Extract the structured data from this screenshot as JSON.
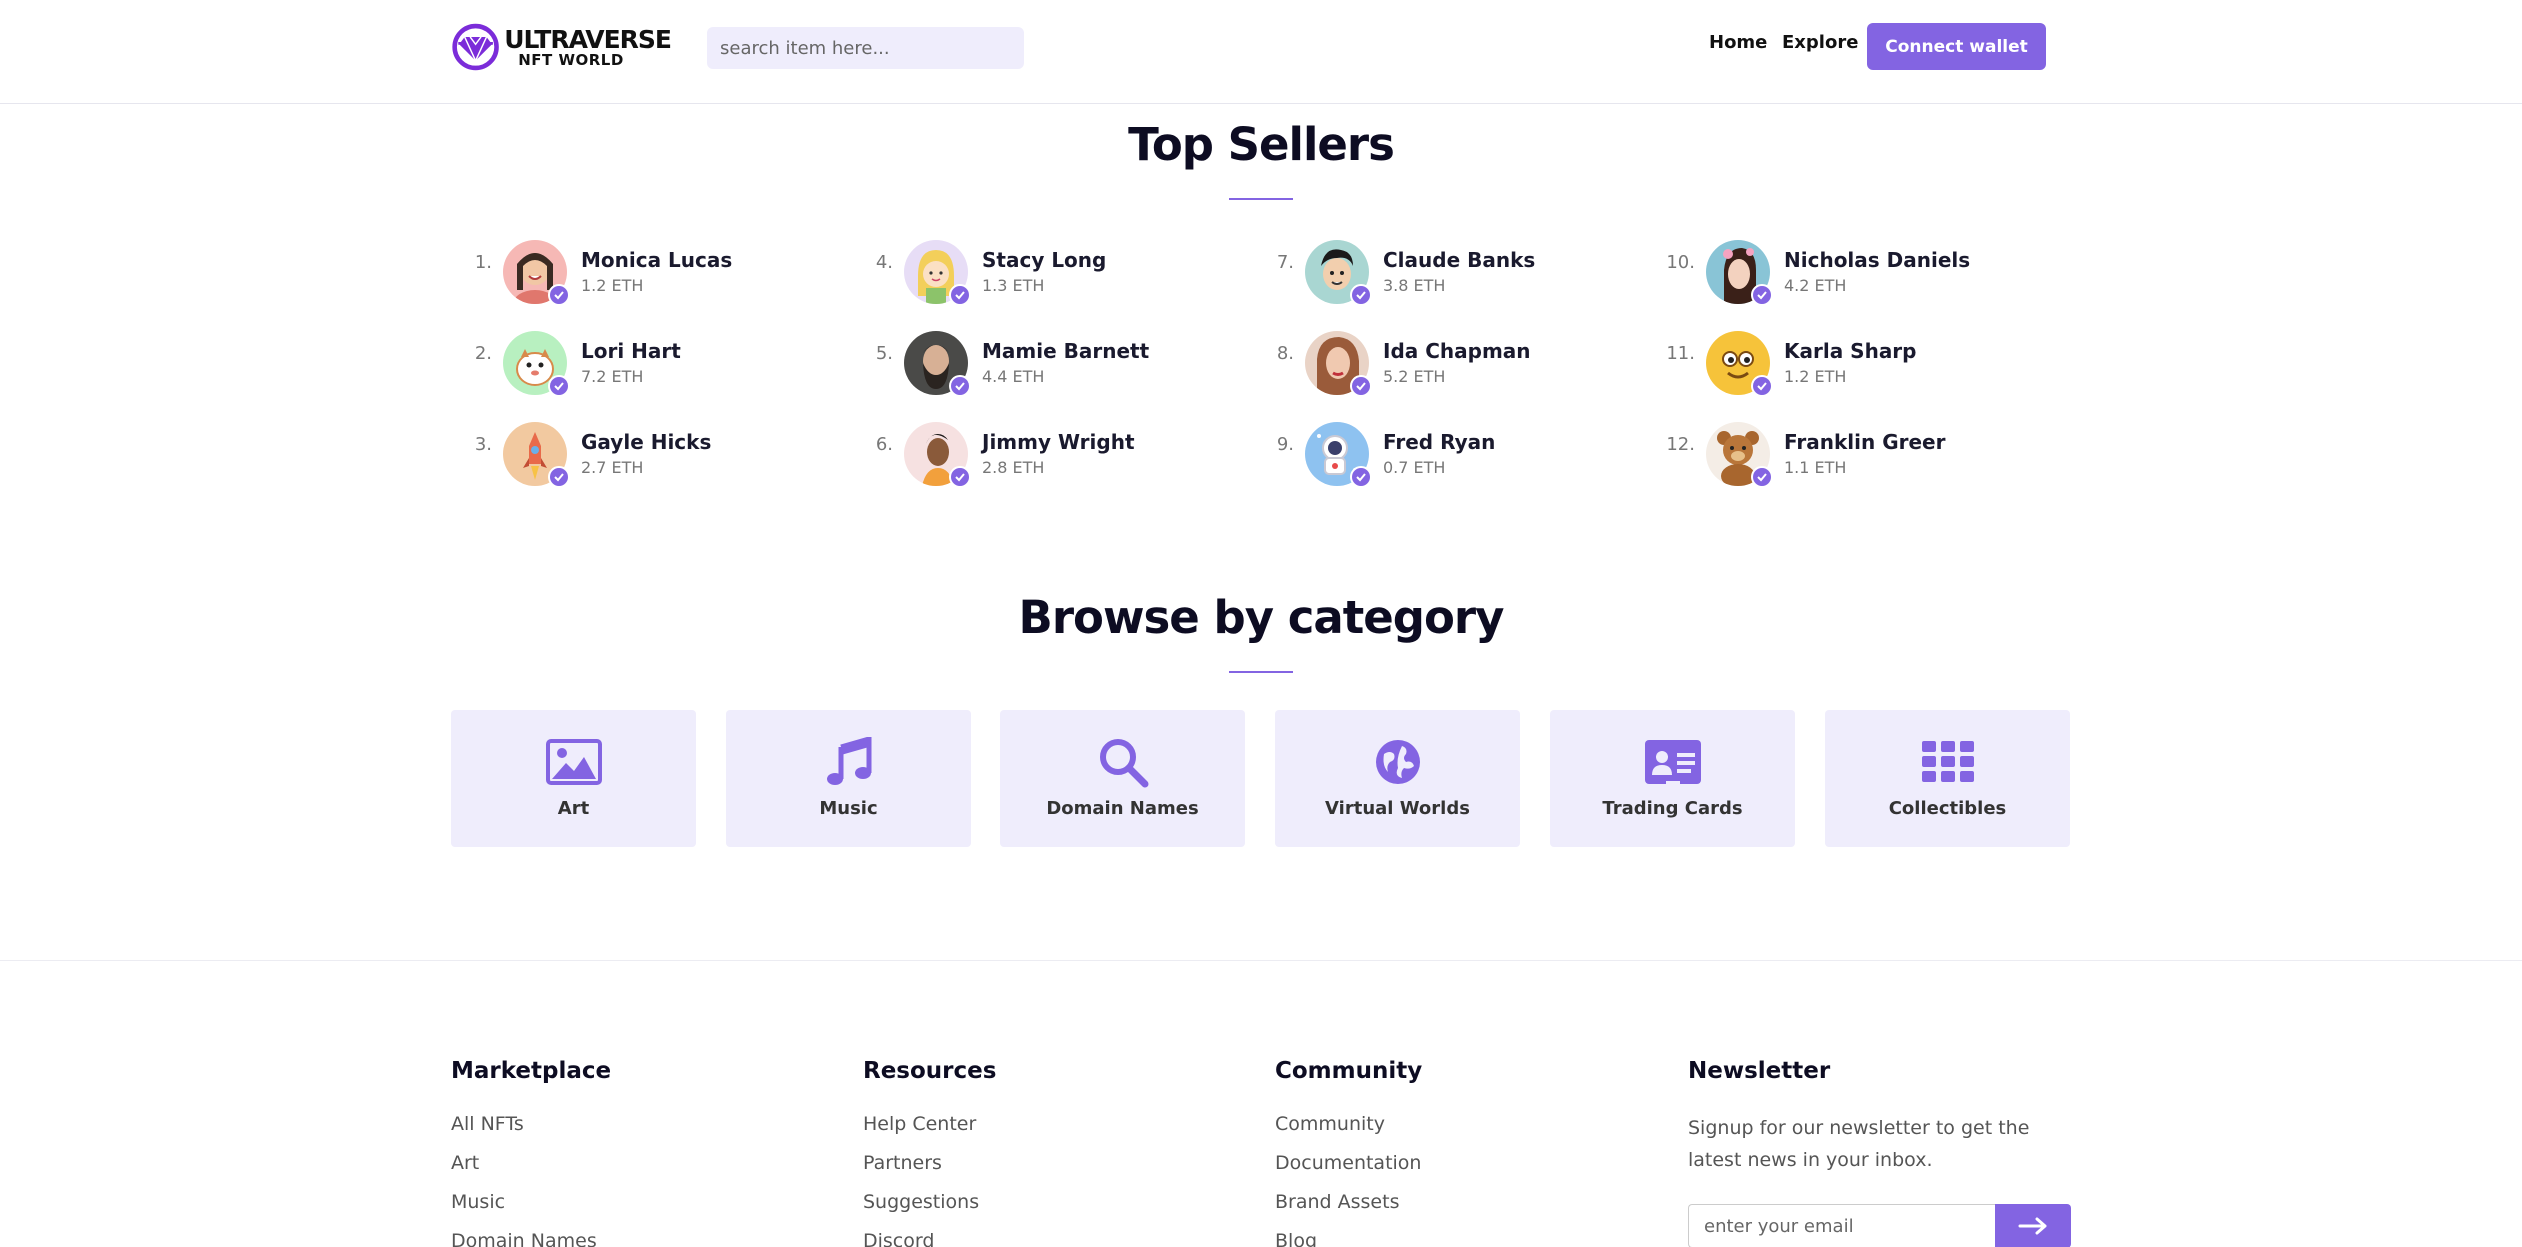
{
  "header": {
    "logo_main": "ULTRAVERSE",
    "logo_sub": "NFT WORLD",
    "search_placeholder": "search item here...",
    "nav": [
      {
        "label": "Home"
      },
      {
        "label": "Explore"
      }
    ],
    "connect_label": "Connect wallet"
  },
  "top_sellers": {
    "title": "Top Sellers",
    "sellers": [
      {
        "rank": "1.",
        "name": "Monica Lucas",
        "eth": "1.2 ETH"
      },
      {
        "rank": "2.",
        "name": "Lori Hart",
        "eth": "7.2 ETH"
      },
      {
        "rank": "3.",
        "name": "Gayle Hicks",
        "eth": "2.7 ETH"
      },
      {
        "rank": "4.",
        "name": "Stacy Long",
        "eth": "1.3 ETH"
      },
      {
        "rank": "5.",
        "name": "Mamie Barnett",
        "eth": "4.4 ETH"
      },
      {
        "rank": "6.",
        "name": "Jimmy Wright",
        "eth": "2.8 ETH"
      },
      {
        "rank": "7.",
        "name": "Claude Banks",
        "eth": "3.8 ETH"
      },
      {
        "rank": "8.",
        "name": "Ida Chapman",
        "eth": "5.2 ETH"
      },
      {
        "rank": "9.",
        "name": "Fred Ryan",
        "eth": "0.7 ETH"
      },
      {
        "rank": "10.",
        "name": "Nicholas Daniels",
        "eth": "4.2 ETH"
      },
      {
        "rank": "11.",
        "name": "Karla Sharp",
        "eth": "1.2 ETH"
      },
      {
        "rank": "12.",
        "name": "Franklin Greer",
        "eth": "1.1 ETH"
      }
    ]
  },
  "categories": {
    "title": "Browse by category",
    "items": [
      {
        "label": "Art",
        "icon": "image-icon"
      },
      {
        "label": "Music",
        "icon": "music-icon"
      },
      {
        "label": "Domain Names",
        "icon": "search-icon"
      },
      {
        "label": "Virtual Worlds",
        "icon": "globe-icon"
      },
      {
        "label": "Trading Cards",
        "icon": "id-card-icon"
      },
      {
        "label": "Collectibles",
        "icon": "grid-icon"
      }
    ]
  },
  "footer": {
    "marketplace": {
      "title": "Marketplace",
      "links": [
        "All NFTs",
        "Art",
        "Music",
        "Domain Names"
      ]
    },
    "resources": {
      "title": "Resources",
      "links": [
        "Help Center",
        "Partners",
        "Suggestions",
        "Discord"
      ]
    },
    "community": {
      "title": "Community",
      "links": [
        "Community",
        "Documentation",
        "Brand Assets",
        "Blog"
      ]
    },
    "newsletter": {
      "title": "Newsletter",
      "text": "Signup for our newsletter to get the latest news in your inbox.",
      "email_placeholder": "enter your email"
    }
  },
  "colors": {
    "accent": "#8364e2",
    "card_bg": "#efedfc"
  }
}
